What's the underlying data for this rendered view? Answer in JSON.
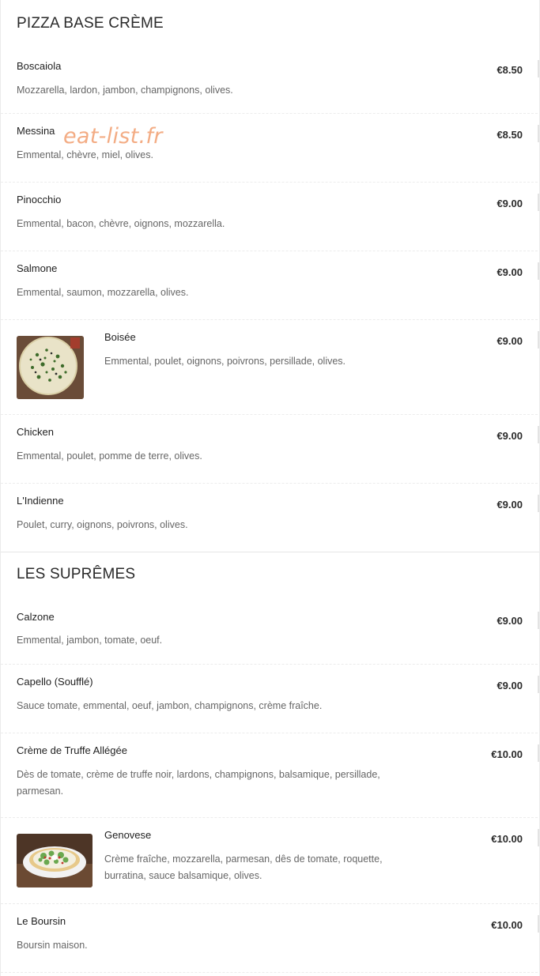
{
  "watermark": "eat-list.fr",
  "sections": [
    {
      "title": "PIZZA BASE CRÈME",
      "items": [
        {
          "name": "Boscaiola",
          "desc": "Mozzarella, lardon, jambon, champignons, olives.",
          "price": "€8.50"
        },
        {
          "name": "Messina",
          "desc": "Emmental, chèvre, miel, olives.",
          "price": "€8.50"
        },
        {
          "name": "Pinocchio",
          "desc": "Emmental, bacon, chèvre, oignons, mozzarella.",
          "price": "€9.00"
        },
        {
          "name": "Salmone",
          "desc": "Emmental, saumon, mozzarella, olives.",
          "price": "€9.00"
        },
        {
          "name": "Boisée",
          "desc": "Emmental, poulet, oignons, poivrons, persillade, olives.",
          "price": "€9.00",
          "image": "pizza-photo"
        },
        {
          "name": "Chicken",
          "desc": "Emmental, poulet, pomme de terre, olives.",
          "price": "€9.00"
        },
        {
          "name": "L'Indienne",
          "desc": "Poulet, curry, oignons, poivrons, olives.",
          "price": "€9.00"
        }
      ]
    },
    {
      "title": "LES SUPRÊMES",
      "items": [
        {
          "name": "Calzone",
          "desc": "Emmental, jambon, tomate, oeuf.",
          "price": "€9.00"
        },
        {
          "name": "Capello (Soufflé)",
          "desc": "Sauce tomate, emmental, oeuf, jambon, champignons, crème fraîche.",
          "price": "€9.00"
        },
        {
          "name": "Crème de Truffe Allégée",
          "desc": "Dès de tomate, crème de truffe noir, lardons, champignons, balsamique, persillade, parmesan.",
          "price": "€10.00"
        },
        {
          "name": "Genovese",
          "desc": "Crème fraîche, mozzarella, parmesan, dês de tomate, roquette, burratina, sauce balsamique, olives.",
          "price": "€10.00",
          "image": "pizza-photo"
        },
        {
          "name": "Le Boursin",
          "desc": "Boursin maison.",
          "price": "€10.00"
        }
      ]
    }
  ]
}
